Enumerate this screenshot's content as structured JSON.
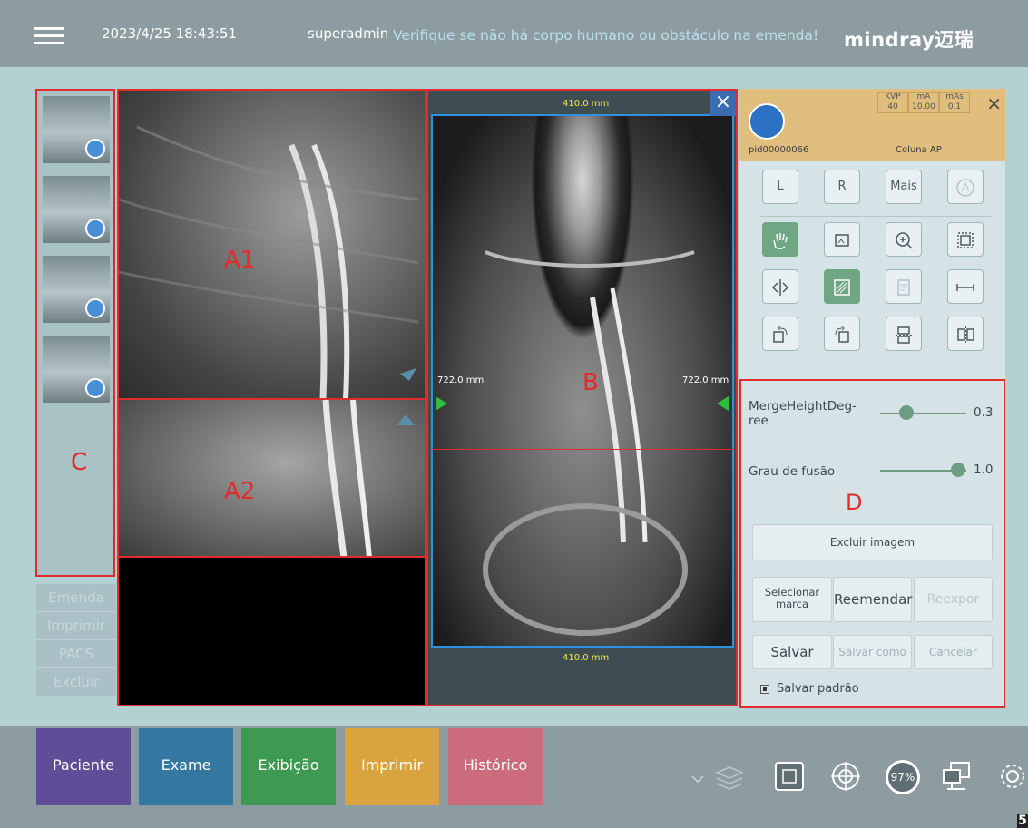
{
  "header": {
    "datetime": "2023/4/25 18:43:51",
    "user": "superadmin",
    "warning": "Verifique se não há corpo humano ou obstáculo na emenda!",
    "logo": "mindray迈瑞"
  },
  "thumbnails": {
    "count": 4,
    "label": "C"
  },
  "sidebar_actions": [
    "Emenda",
    "Imprimir",
    "PACS",
    "Excluir"
  ],
  "viewers": {
    "a1_label": "A1",
    "a2_label": "A2",
    "b_label": "B",
    "b_width_top": "410.0 mm",
    "b_width_bottom": "410.0 mm",
    "b_overlap_left": "722.0 mm",
    "b_overlap_right": "722.0 mm",
    "b_close": "×"
  },
  "patient": {
    "id": "pid00000066",
    "protocol": "Coluna AP",
    "tech": [
      {
        "name": "KVP",
        "value": "40"
      },
      {
        "name": "mA",
        "value": "10.00"
      },
      {
        "name": "mAs",
        "value": "0.1"
      }
    ],
    "close": "×"
  },
  "tools": {
    "row1": [
      "L",
      "R",
      "Mais"
    ],
    "icons": [
      "pan-hand-icon",
      "crop-icon",
      "zoom-in-icon",
      "select-area-icon",
      "flip-horizontal-icon",
      "invert-icon",
      "report-icon",
      "measure-ruler-icon",
      "rotate-left-icon",
      "rotate-right-icon",
      "split-horizontal-icon",
      "split-vertical-icon"
    ]
  },
  "stitch_panel": {
    "label": "D",
    "merge_height_label": "MergeHeightDeg-ree",
    "merge_height_value": "0.3",
    "merge_height_level": 0.3,
    "fusion_label": "Grau de fusão",
    "fusion_value": "1.0",
    "fusion_level": 1.0,
    "delete_button": "Excluir imagem",
    "select_mark_button": "Selecionar marca",
    "restitch_button": "Reemendar",
    "reexpose_button": "Reexpor",
    "save_button": "Salvar",
    "save_as_button": "Salvar como",
    "cancel_button": "Cancelar",
    "save_default_label": "Salvar padrão",
    "save_default_checked": true
  },
  "bottom_nav": [
    {
      "label": "Paciente",
      "color": "#5f4d97"
    },
    {
      "label": "Exame",
      "color": "#3478a1"
    },
    {
      "label": "Exibição",
      "color": "#3e9a52"
    },
    {
      "label": "Imprimir",
      "color": "#d9a43e"
    },
    {
      "label": "Histórico",
      "color": "#cb6b7b"
    }
  ],
  "status": {
    "zoom": "97%",
    "corner": "5"
  }
}
